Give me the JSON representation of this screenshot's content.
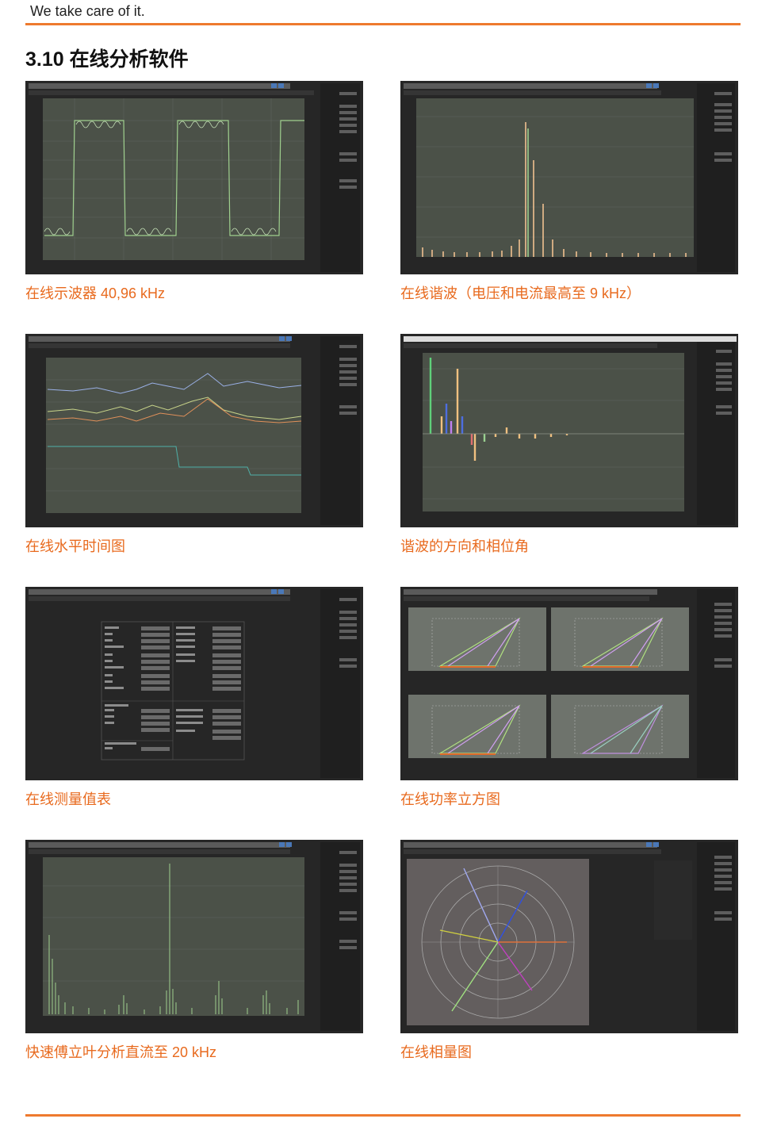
{
  "header": {
    "tagline": "We take care of it."
  },
  "section": {
    "title": "3.10 在线分析软件"
  },
  "figures": [
    {
      "caption": "在线示波器 40,96 kHz",
      "screen": "oscilloscope"
    },
    {
      "caption": "在线谐波（电压和电流最高至 9 kHz）",
      "screen": "harmonics-bar"
    },
    {
      "caption": "在线水平时间图",
      "screen": "time-trend"
    },
    {
      "caption": "谐波的方向和相位角",
      "screen": "harmonic-direction"
    },
    {
      "caption": "在线测量值表",
      "screen": "measurement-table"
    },
    {
      "caption": "在线功率立方图",
      "screen": "power-cube"
    },
    {
      "caption": "快速傅立叶分析直流至 20 kHz",
      "screen": "fft"
    },
    {
      "caption": "在线相量图",
      "screen": "phasor"
    }
  ],
  "colors": {
    "accent": "#ee7a2e",
    "caption": "#e86a1e",
    "screen_bg": "#262626",
    "plot_bg": "#4b5148"
  }
}
